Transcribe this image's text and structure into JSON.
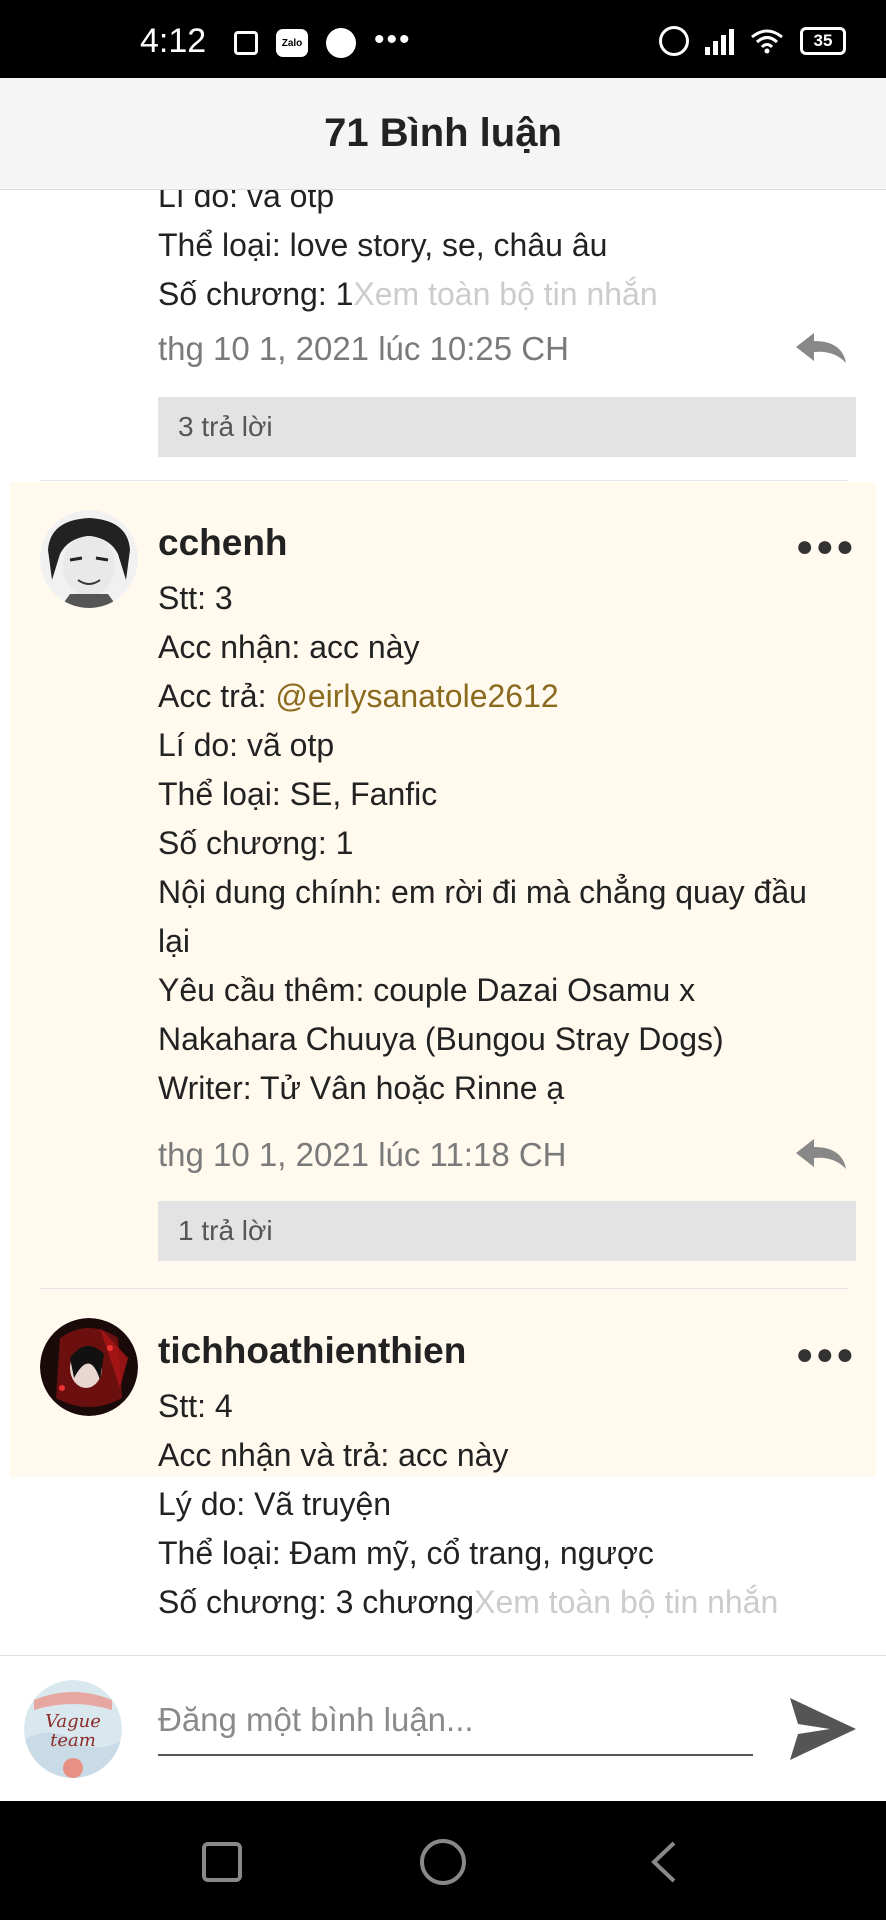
{
  "status_bar": {
    "time": "4:12",
    "zalo_label": "Zalo",
    "battery": "35",
    "icons": [
      "calendar-icon",
      "zalo-icon",
      "messenger-icon",
      "more-dots-icon",
      "alarm-icon",
      "signal-icon",
      "wifi-icon",
      "battery-icon"
    ]
  },
  "header": {
    "title": "71 Bình luận"
  },
  "comments": [
    {
      "lines": [
        "Lí do: vã otp",
        "Thể loại: love story, se, châu âu",
        "Số chương: 1"
      ],
      "see_more": "Xem toàn bộ tin nhắn",
      "timestamp": "thg 10 1, 2021 lúc 10:25 CH",
      "replies": "3 trả lời"
    },
    {
      "username": "cchenh",
      "lines": [
        "Stt: 3",
        "Acc nhận: acc này"
      ],
      "acc_tra_label": "Acc trả: ",
      "mention": "@eirlysanatole2612",
      "lines2": [
        "Lí do: vã otp",
        "Thể loại: SE, Fanfic",
        "Số chương: 1",
        "Nội dung chính: em rời đi mà chẳng quay đầu",
        "lại",
        "Yêu cầu thêm: couple Dazai Osamu x",
        "Nakahara Chuuya (Bungou Stray Dogs)",
        "Writer: Tử Vân hoặc Rinne ạ"
      ],
      "timestamp": "thg 10 1, 2021 lúc 11:18 CH",
      "replies": "1 trả lời",
      "highlighted": true
    },
    {
      "username": "tichhoathienthien",
      "lines": [
        "Stt: 4",
        "Acc nhận và trả: acc này",
        "Lý do: Vã truyện",
        "Thể loại: Đam mỹ, cổ trang, ngược",
        "Số chương: 3 chương"
      ],
      "see_more": "Xem toàn bộ tin nhắn"
    }
  ],
  "composer": {
    "placeholder": "Đăng một bình luận...",
    "avatar_text_1": "Vague",
    "avatar_text_2": "team"
  },
  "colors": {
    "highlight_bg": "#fff9ee",
    "mention": "#8a6b1e",
    "reply_box": "#e3e3e3"
  }
}
